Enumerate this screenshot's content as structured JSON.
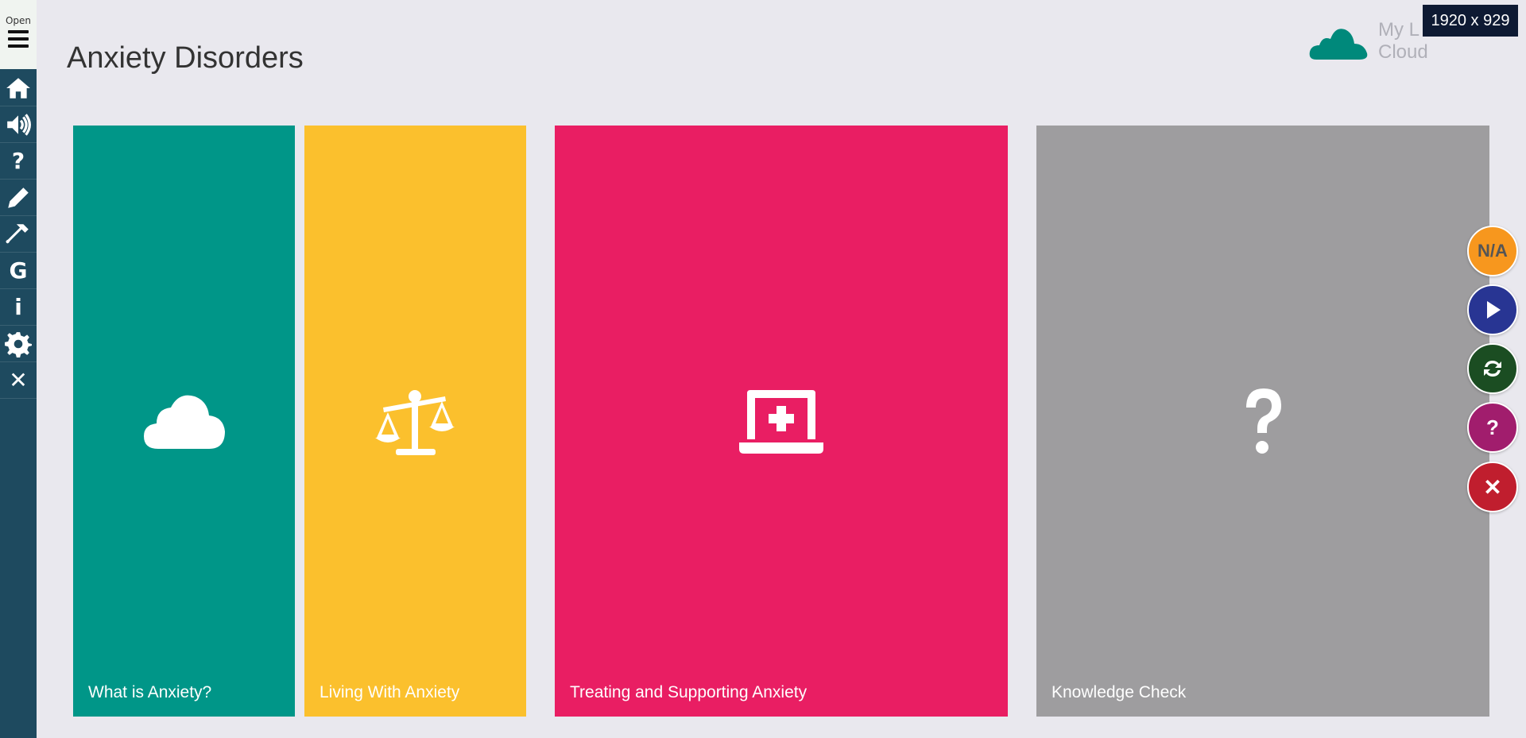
{
  "sidebar": {
    "open_label": "Open",
    "items": [
      {
        "name": "home",
        "icon": "home-icon"
      },
      {
        "name": "audio",
        "icon": "volume-icon"
      },
      {
        "name": "help",
        "label": "?",
        "icon": "question-icon"
      },
      {
        "name": "edit",
        "icon": "pencil-icon"
      },
      {
        "name": "tools",
        "icon": "hammer-icon"
      },
      {
        "name": "glossary",
        "label": "G",
        "icon": "g-letter-icon"
      },
      {
        "name": "info",
        "label": "i",
        "icon": "info-icon"
      },
      {
        "name": "settings",
        "icon": "gear-icon"
      },
      {
        "name": "exit",
        "label": "✕",
        "icon": "close-icon"
      }
    ]
  },
  "header": {
    "title": "Anxiety Disorders",
    "brand_line1": "My L",
    "brand_line2": "Cloud",
    "size_badge": "1920 x 929"
  },
  "tiles": [
    {
      "label": "What is Anxiety?",
      "icon": "cloud-icon",
      "color": "#009688"
    },
    {
      "label": "Living With Anxiety",
      "icon": "balance-scale-icon",
      "color": "#fbc02d"
    },
    {
      "label": "Treating and Supporting Anxiety",
      "icon": "laptop-medical-icon",
      "color": "#e91e63"
    },
    {
      "label": "Knowledge Check",
      "icon": "question-icon",
      "color": "#9e9d9f"
    }
  ],
  "fabs": {
    "na_label": "N/A",
    "help_label": "?",
    "close_label": "✕"
  }
}
